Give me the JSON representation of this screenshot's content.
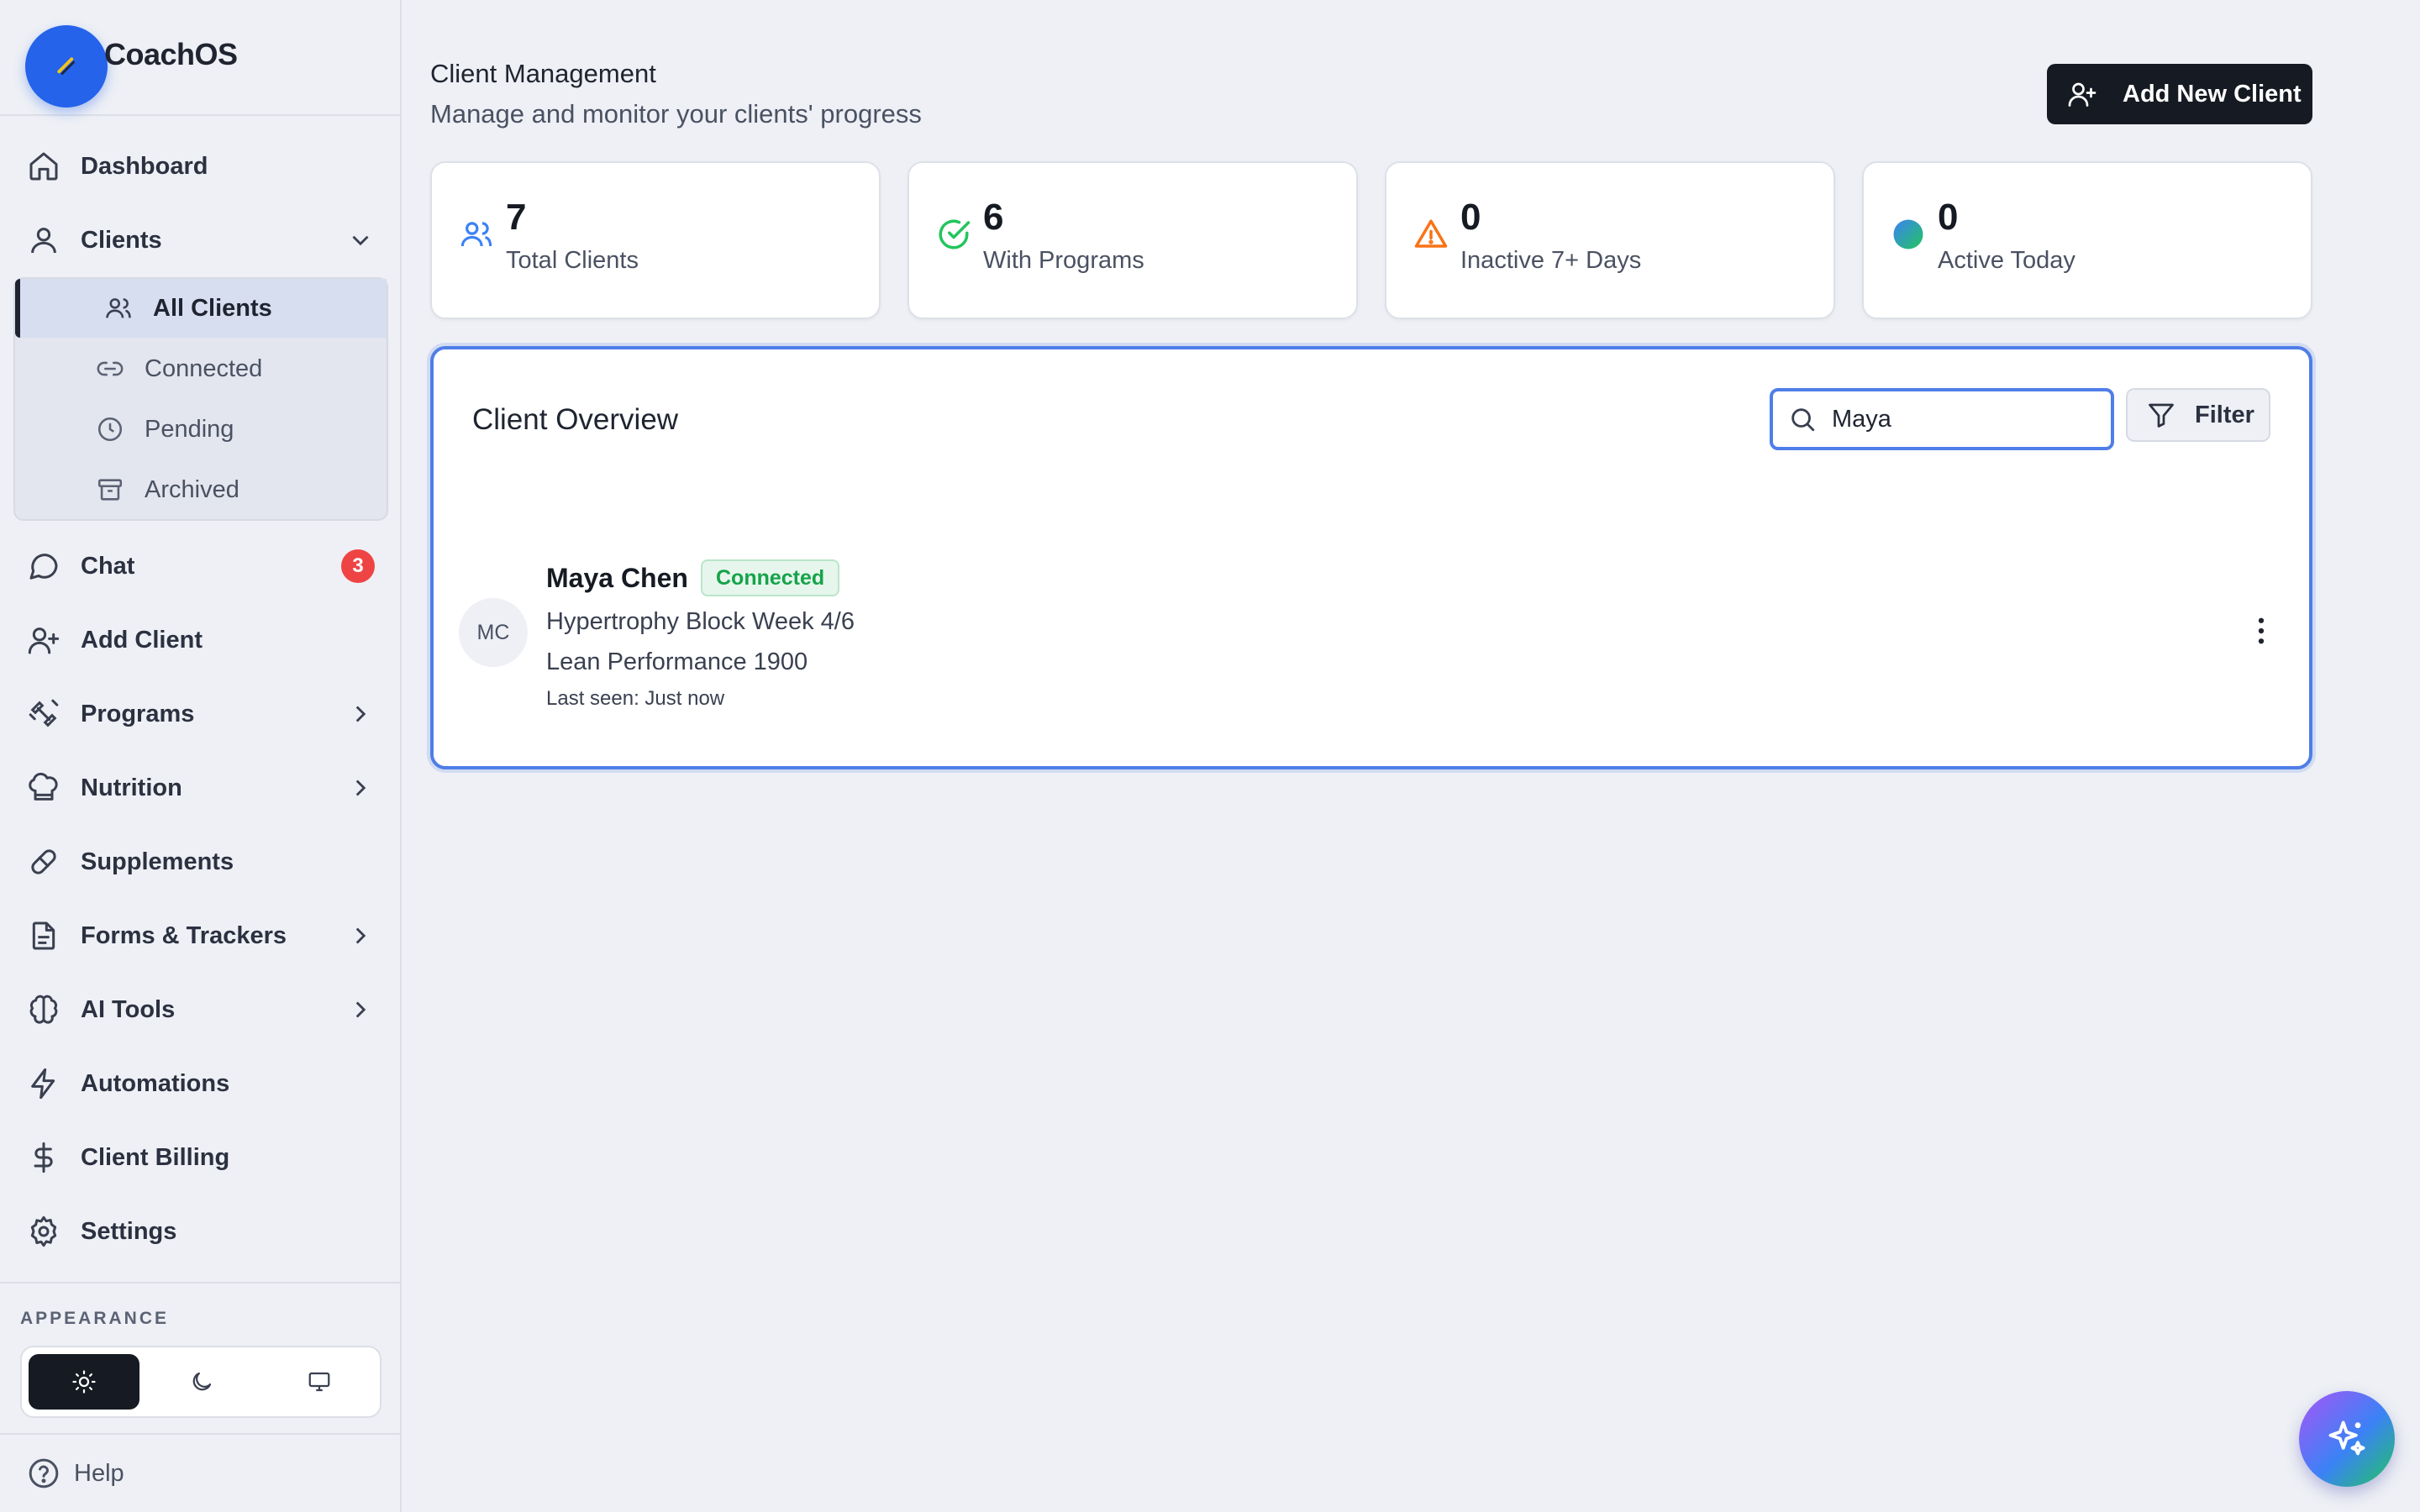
{
  "app": {
    "name": "CoachOS"
  },
  "sidebar": {
    "items": [
      {
        "label": "Dashboard",
        "icon": "home-icon"
      },
      {
        "label": "Clients",
        "icon": "user-icon",
        "expanded": true
      },
      {
        "label": "Chat",
        "icon": "chat-icon",
        "badge": "3"
      },
      {
        "label": "Add Client",
        "icon": "user-plus-icon"
      },
      {
        "label": "Programs",
        "icon": "dumbbell-icon"
      },
      {
        "label": "Nutrition",
        "icon": "chef-hat-icon"
      },
      {
        "label": "Supplements",
        "icon": "pill-icon"
      },
      {
        "label": "Forms & Trackers",
        "icon": "document-icon"
      },
      {
        "label": "AI Tools",
        "icon": "brain-icon"
      },
      {
        "label": "Automations",
        "icon": "lightning-icon"
      },
      {
        "label": "Client Billing",
        "icon": "dollar-icon"
      },
      {
        "label": "Settings",
        "icon": "gear-icon"
      }
    ],
    "clients_sub": [
      {
        "label": "All Clients",
        "icon": "users-icon",
        "active": true
      },
      {
        "label": "Connected",
        "icon": "link-icon"
      },
      {
        "label": "Pending",
        "icon": "clock-icon"
      },
      {
        "label": "Archived",
        "icon": "archive-icon"
      }
    ],
    "appearance_title": "APPEARANCE",
    "theme_options": [
      "light",
      "dark",
      "system"
    ],
    "theme_selected": "light",
    "help_label": "Help"
  },
  "header": {
    "title": "Client Management",
    "subtitle": "Manage and monitor your clients' progress",
    "add_button": "Add New Client"
  },
  "stats": [
    {
      "value": "7",
      "label": "Total Clients",
      "icon": "users-icon",
      "color": "#3b82f6"
    },
    {
      "value": "6",
      "label": "With Programs",
      "icon": "check-circle-icon",
      "color": "#22c55e"
    },
    {
      "value": "0",
      "label": "Inactive 7+ Days",
      "icon": "warning-icon",
      "color": "#f97316"
    },
    {
      "value": "0",
      "label": "Active Today",
      "icon": "active-dot-icon",
      "color": "#14b8a6"
    }
  ],
  "overview": {
    "title": "Client Overview",
    "search_value": "Maya",
    "filter_label": "Filter",
    "clients": [
      {
        "initials": "MC",
        "name": "Maya Chen",
        "status": "Connected",
        "program": "Hypertrophy Block Week 4/6",
        "nutrition": "Lean Performance 1900",
        "last_seen": "Last seen: Just now"
      }
    ]
  },
  "colors": {
    "accent": "#2563eb",
    "focus_border": "#4f7ee8",
    "dark_button": "#161a22",
    "badge_red": "#ef4444",
    "connected_green": "#16a34a"
  }
}
